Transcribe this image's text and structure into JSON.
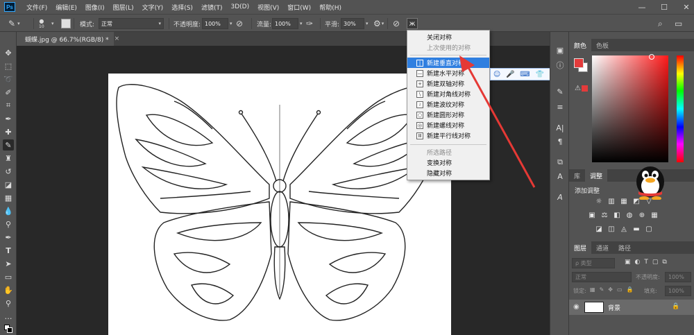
{
  "menubar": {
    "logo": "Ps",
    "items": [
      "文件(F)",
      "编辑(E)",
      "图像(I)",
      "图层(L)",
      "文字(Y)",
      "选择(S)",
      "滤镜(T)",
      "3D(D)",
      "视图(V)",
      "窗口(W)",
      "帮助(H)"
    ],
    "win_buttons": [
      "—",
      "☐",
      "✕"
    ]
  },
  "options": {
    "brush_size": "10",
    "mode_label": "模式:",
    "mode_value": "正常",
    "opacity_label": "不透明度:",
    "opacity_value": "100%",
    "flow_label": "流量:",
    "flow_value": "100%",
    "smooth_label": "平滑:",
    "smooth_value": "30%"
  },
  "document": {
    "tab_title": "蝴蝶.jpg @ 66.7%(RGB/8) *",
    "close": "×"
  },
  "symmetry_menu": {
    "items": [
      {
        "label": "关闭对称",
        "state": "normal",
        "icon": ""
      },
      {
        "label": "上次使用的对称",
        "state": "disabled",
        "icon": ""
      },
      {
        "label": "新建垂直对称",
        "state": "highlighted",
        "icon": "|"
      },
      {
        "label": "新建水平对称",
        "state": "normal",
        "icon": "—"
      },
      {
        "label": "新建双轴对称",
        "state": "normal",
        "icon": "+"
      },
      {
        "label": "新建对角线对称",
        "state": "normal",
        "icon": "\\"
      },
      {
        "label": "新建波纹对称",
        "state": "normal",
        "icon": "≀"
      },
      {
        "label": "新建圆形对称",
        "state": "normal",
        "icon": "○"
      },
      {
        "label": "新建螺线对称",
        "state": "normal",
        "icon": "◎"
      },
      {
        "label": "新建平行线对称",
        "state": "normal",
        "icon": "Ⅲ"
      },
      {
        "label": "所选路径",
        "state": "disabled",
        "icon": ""
      },
      {
        "label": "变换对称",
        "state": "normal",
        "icon": ""
      },
      {
        "label": "隐藏对称",
        "state": "normal",
        "icon": ""
      }
    ]
  },
  "ime_bar": {
    "icons": [
      "☺",
      "🎤",
      "⌨",
      "👕",
      "🔧"
    ]
  },
  "color_panel": {
    "tabs": [
      "颜色",
      "色板"
    ],
    "fg_color": "#e33b3b",
    "bg_color": "#ffffff"
  },
  "adjust_panel": {
    "tabs": [
      "库",
      "调整"
    ],
    "title": "添加调整",
    "row1": [
      "☼",
      "▥",
      "▦",
      "◩",
      "▽"
    ],
    "row2": [
      "▣",
      "⚖",
      "◧",
      "◍",
      "⊕",
      "▦"
    ],
    "row3": [
      "◪",
      "◫",
      "◬",
      "▬",
      "▢"
    ]
  },
  "layers_panel": {
    "tabs": [
      "图层",
      "通道",
      "路径"
    ],
    "kind_placeholder": "ρ 类型",
    "blend_mode": "正常",
    "opacity_label": "不透明度:",
    "opacity_value": "100%",
    "lock_label": "锁定:",
    "fill_label": "填充:",
    "fill_value": "100%",
    "layer_name": "背景"
  },
  "colors": {
    "arrow": "#e53935",
    "menu_highlight": "#2f7fe0"
  }
}
